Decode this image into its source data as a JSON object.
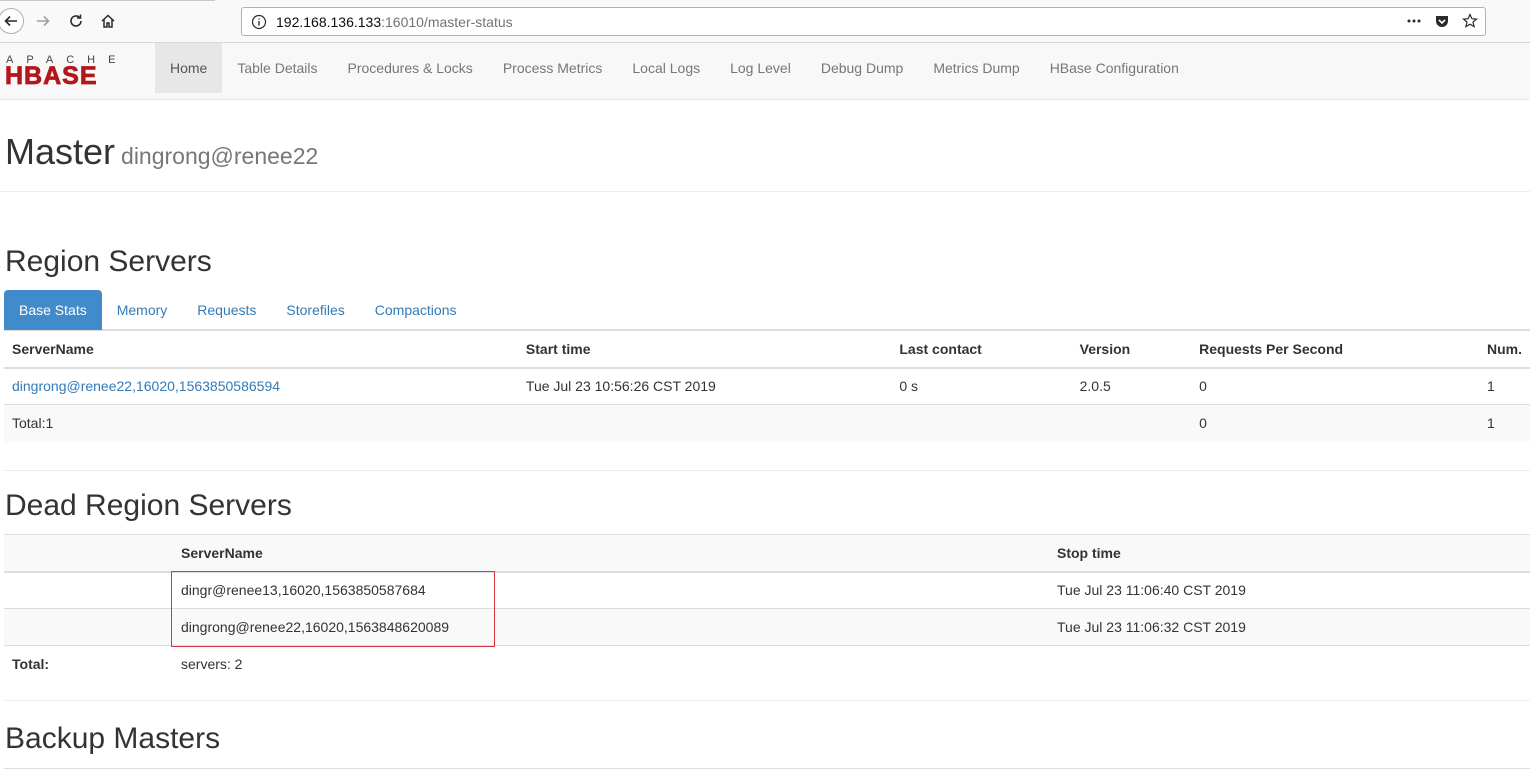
{
  "browser": {
    "url_host": "192.168.136.133",
    "url_path": ":16010/master-status"
  },
  "nav": {
    "logo_top": "APACHE",
    "logo_main": "HBASE",
    "items": [
      {
        "label": "Home",
        "active": true
      },
      {
        "label": "Table Details"
      },
      {
        "label": "Procedures & Locks"
      },
      {
        "label": "Process Metrics"
      },
      {
        "label": "Local Logs"
      },
      {
        "label": "Log Level"
      },
      {
        "label": "Debug Dump"
      },
      {
        "label": "Metrics Dump"
      },
      {
        "label": "HBase Configuration"
      }
    ]
  },
  "header": {
    "title": "Master",
    "subtitle": "dingrong@renee22"
  },
  "region_servers": {
    "heading": "Region Servers",
    "tabs": [
      "Base Stats",
      "Memory",
      "Requests",
      "Storefiles",
      "Compactions"
    ],
    "columns": [
      "ServerName",
      "Start time",
      "Last contact",
      "Version",
      "Requests Per Second",
      "Num."
    ],
    "rows": [
      [
        "dingrong@renee22,16020,1563850586594",
        "Tue Jul 23 10:56:26 CST 2019",
        "0 s",
        "2.0.5",
        "0",
        "1"
      ]
    ],
    "total": [
      "Total:1",
      "",
      "",
      "",
      "0",
      "1"
    ]
  },
  "dead_region_servers": {
    "heading": "Dead Region Servers",
    "columns": [
      "",
      "ServerName",
      "Stop time"
    ],
    "rows": [
      [
        "",
        "dingr@renee13,16020,1563850587684",
        "Tue Jul 23 11:06:40 CST 2019"
      ],
      [
        "",
        "dingrong@renee22,16020,1563848620089",
        "Tue Jul 23 11:06:32 CST 2019"
      ]
    ],
    "total_label": "Total:",
    "total_value": "servers: 2"
  },
  "backup_masters": {
    "heading": "Backup Masters"
  },
  "colors": {
    "link": "#337ab7",
    "active_tab": "#428bca",
    "logo_red": "#b3171b",
    "highlight": "#d9363e"
  }
}
